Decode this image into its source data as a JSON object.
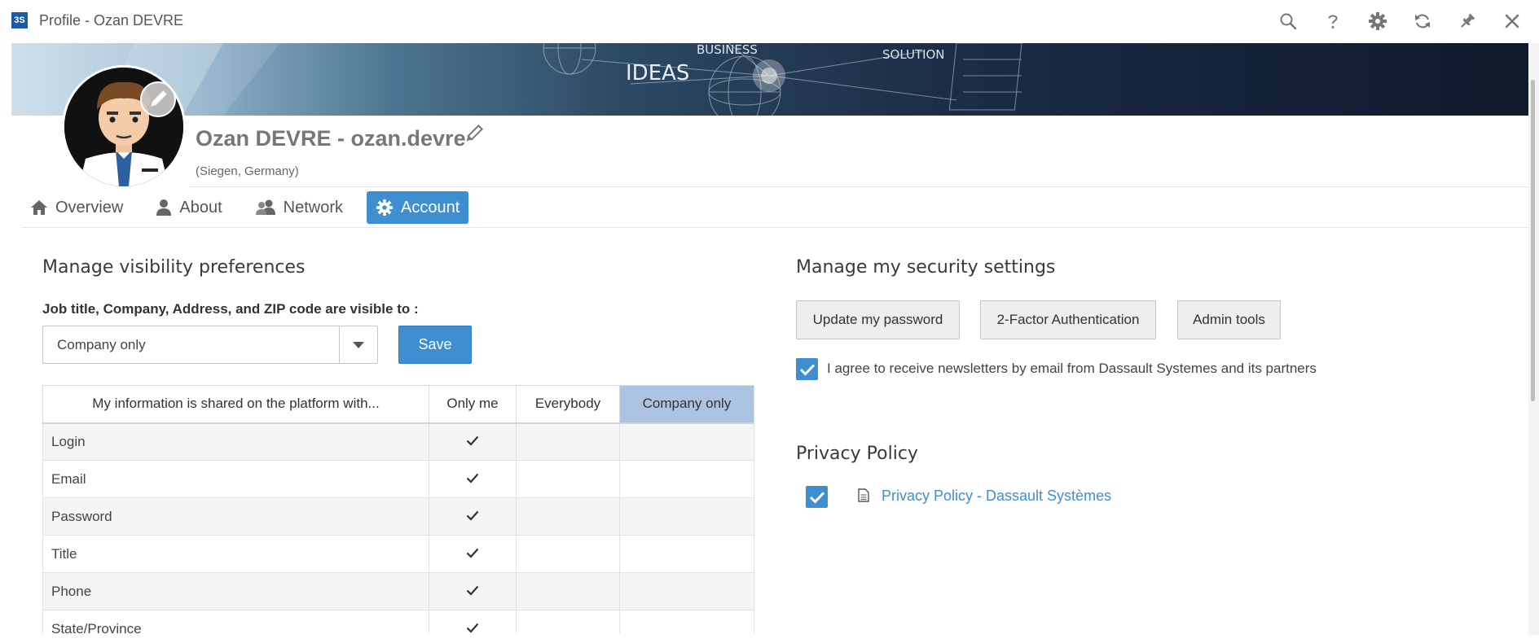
{
  "window": {
    "title": "Profile - Ozan DEVRE",
    "logo_text": "3S"
  },
  "toolbar": {
    "icons": [
      "search-icon",
      "help-icon",
      "gear-icon",
      "refresh-icon",
      "pin-icon",
      "close-icon"
    ]
  },
  "banner": {
    "words": [
      "BUSINESS",
      "IDEAS",
      "SOLUTION"
    ]
  },
  "profile": {
    "name": "Ozan DEVRE - ozan.devre",
    "location": "(Siegen, Germany)"
  },
  "tabs": [
    {
      "label": "Overview",
      "icon": "home-icon",
      "active": false
    },
    {
      "label": "About",
      "icon": "person-icon",
      "active": false
    },
    {
      "label": "Network",
      "icon": "people-icon",
      "active": false
    },
    {
      "label": "Account",
      "icon": "gear-icon",
      "active": true
    }
  ],
  "visibility": {
    "title": "Manage visibility preferences",
    "label": "Job title, Company, Address, and ZIP code are visible to :",
    "selected": "Company only",
    "save_label": "Save",
    "table": {
      "headers": [
        "My information is shared on the platform with...",
        "Only me",
        "Everybody",
        "Company only"
      ],
      "highlight_column": "Company only",
      "rows": [
        {
          "label": "Login",
          "only_me": true,
          "everybody": false,
          "company_only": false
        },
        {
          "label": "Email",
          "only_me": true,
          "everybody": false,
          "company_only": false
        },
        {
          "label": "Password",
          "only_me": true,
          "everybody": false,
          "company_only": false
        },
        {
          "label": "Title",
          "only_me": true,
          "everybody": false,
          "company_only": false
        },
        {
          "label": "Phone",
          "only_me": true,
          "everybody": false,
          "company_only": false
        },
        {
          "label": "State/Province",
          "only_me": true,
          "everybody": false,
          "company_only": false
        }
      ]
    }
  },
  "security": {
    "title": "Manage my security settings",
    "buttons": [
      "Update my password",
      "2-Factor Authentication",
      "Admin tools"
    ],
    "newsletter": {
      "checked": true,
      "text": "I agree to receive newsletters by email from Dassault Systemes and its partners"
    }
  },
  "privacy": {
    "title": "Privacy Policy",
    "checked": true,
    "link_text": "Privacy Policy - Dassault Systèmes"
  },
  "colors": {
    "accent": "#3e8ed0",
    "highlight_header": "#adc3e3"
  }
}
